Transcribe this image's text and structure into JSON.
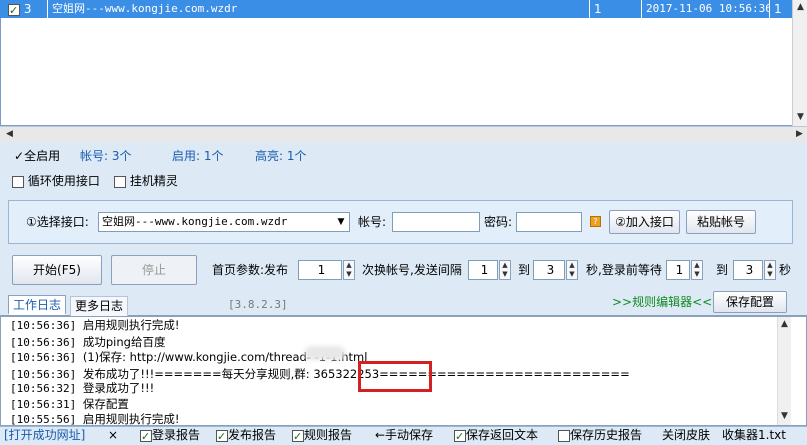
{
  "list": {
    "rows": [
      {
        "checked": true,
        "index": "3",
        "name": "空姐网---www.kongjie.com.wzdr",
        "count": "1",
        "time": "2017-11-06 10:56:36",
        "num": "1"
      }
    ]
  },
  "summary": {
    "enable_all": "全启用",
    "accounts": "帐号: 3个",
    "enabled": "启用: 1个",
    "highlight": "高亮: 1个"
  },
  "options": {
    "loop_interface": "循环使用接口",
    "hang_elf": "挂机精灵"
  },
  "interface": {
    "select_label": "①选择接口:",
    "select_value": "空姐网---www.kongjie.com.wzdr",
    "account_label": "帐号:",
    "account_value": "",
    "password_label": "密码:",
    "password_value": "",
    "add_button": "②加入接口",
    "paste_button": "粘贴帐号"
  },
  "controls": {
    "start_button": "开始(F5)",
    "stop_button": "停止",
    "home_params": "首页参数:发布",
    "publish_value": "1",
    "switch_account": "次换帐号,发送间隔",
    "interval_from": "1",
    "to1": "到",
    "interval_to": "3",
    "seconds_login_wait": "秒,登录前等待",
    "wait_from": "1",
    "to2": "到",
    "wait_to": "3",
    "seconds": "秒"
  },
  "log": {
    "tab_work": "工作日志",
    "tab_more": "更多日志",
    "version": "[3.8.2.3]",
    "rules_editor": ">>规则编辑器<<",
    "save_config": "保存配置",
    "lines": [
      {
        "time": "[10:56:36]",
        "text": "启用规则执行完成!"
      },
      {
        "time": "[10:56:36]",
        "text": "成功ping给百度"
      },
      {
        "time": "[10:56:36]",
        "text": "(1)保存: http://www.kongjie.com/thread-      -1-1.html"
      },
      {
        "time": "[10:56:36]",
        "text": "发布成功了!!!=======每天分享规则,群: 365322253=========================="
      },
      {
        "time": "[10:56:32]",
        "text": "登录成功了!!!"
      },
      {
        "time": "[10:56:31]",
        "text": "保存配置"
      },
      {
        "time": "[10:55:56]",
        "text": "启用规则执行完成!"
      }
    ]
  },
  "statusbar": {
    "open_success": "[打开成功网址]",
    "close_x": "×",
    "login_report": "登录报告",
    "publish_report": "发布报告",
    "rules_report": "规则报告",
    "manual_save": "←手动保存",
    "save_return_text": "保存返回文本",
    "save_history_report": "保存历史报告",
    "close_skin": "关闭皮肤",
    "collector": "收集器1.txt"
  }
}
